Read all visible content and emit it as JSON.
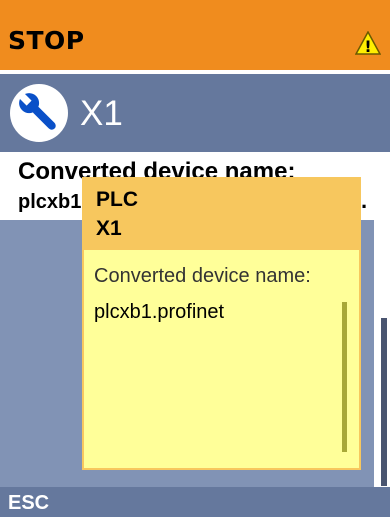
{
  "status": {
    "text": "STOP",
    "warning_icon": "warning-icon",
    "warning_symbol": "!"
  },
  "title": {
    "icon": "wrench-icon",
    "text": "X1"
  },
  "detail": {
    "label": "Converted device name:",
    "value": "plcxb1",
    "ellipsis": "."
  },
  "tooltip": {
    "title_line1": "PLC",
    "title_line2": "X1",
    "label": "Converted device name:",
    "value": "plcxb1.profinet"
  },
  "footer": {
    "esc_label": "ESC"
  },
  "colors": {
    "status_bar": "#f08c1e",
    "title_bar": "#65789d",
    "tooltip_bg": "#ffff99",
    "tooltip_header": "#f7c75e"
  }
}
